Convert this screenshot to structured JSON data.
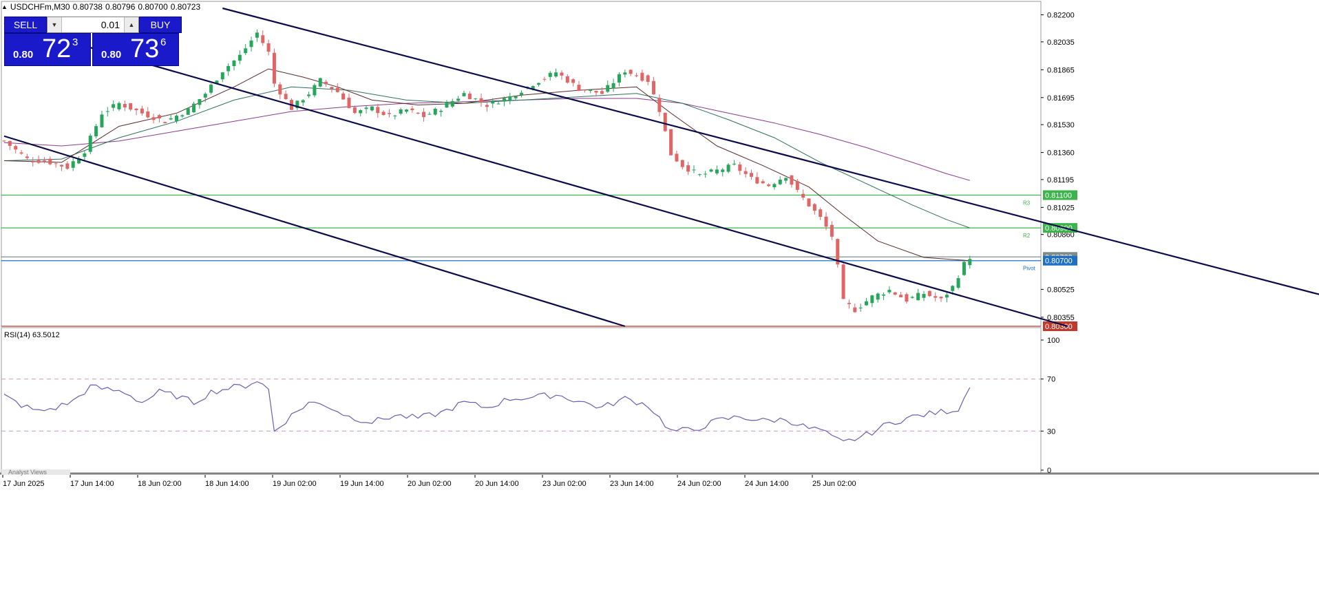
{
  "header": {
    "symbol": "USDCHFm,M30",
    "open": "0.80738",
    "high": "0.80796",
    "low": "0.80700",
    "close": "0.80723"
  },
  "trade_panel": {
    "sell_label": "SELL",
    "buy_label": "BUY",
    "lot": "0.01",
    "sell_prefix": "0.80",
    "sell_big": "72",
    "sell_sup": "3",
    "buy_prefix": "0.80",
    "buy_big": "73",
    "buy_sup": "6"
  },
  "bottom_tab": "Analyst Views",
  "chart_data": [
    {
      "type": "candlestick",
      "title": "USDCHFm,M30",
      "ylim": [
        0.803,
        0.8224
      ],
      "y_ticks": [
        "0.82200",
        "0.82035",
        "0.81865",
        "0.81695",
        "0.81530",
        "0.81360",
        "0.81195",
        "0.81025",
        "0.80860",
        "0.80525",
        "0.80355"
      ],
      "x_ticks": [
        "17 Jun 2025",
        "17 Jun 14:00",
        "18 Jun 02:00",
        "18 Jun 14:00",
        "19 Jun 02:00",
        "19 Jun 14:00",
        "20 Jun 02:00",
        "20 Jun 14:00",
        "23 Jun 02:00",
        "23 Jun 14:00",
        "24 Jun 02:00",
        "24 Jun 14:00",
        "25 Jun 02:00"
      ],
      "close_path": [
        [
          0,
          0.8143
        ],
        [
          4,
          0.8132
        ],
        [
          8,
          0.813
        ],
        [
          11,
          0.8127
        ],
        [
          14,
          0.8137
        ],
        [
          17,
          0.816
        ],
        [
          20,
          0.8166
        ],
        [
          24,
          0.816
        ],
        [
          28,
          0.8155
        ],
        [
          32,
          0.8162
        ],
        [
          35,
          0.8172
        ],
        [
          38,
          0.8186
        ],
        [
          41,
          0.8195
        ],
        [
          44,
          0.8209
        ],
        [
          46,
          0.8197
        ],
        [
          47,
          0.8178
        ],
        [
          50,
          0.8163
        ],
        [
          53,
          0.8172
        ],
        [
          55,
          0.818
        ],
        [
          58,
          0.8173
        ],
        [
          61,
          0.816
        ],
        [
          64,
          0.8163
        ],
        [
          67,
          0.8158
        ],
        [
          70,
          0.8162
        ],
        [
          73,
          0.8158
        ],
        [
          76,
          0.8163
        ],
        [
          80,
          0.8172
        ],
        [
          84,
          0.8165
        ],
        [
          88,
          0.817
        ],
        [
          92,
          0.8178
        ],
        [
          96,
          0.8185
        ],
        [
          100,
          0.8175
        ],
        [
          104,
          0.8172
        ],
        [
          108,
          0.8186
        ],
        [
          112,
          0.818
        ],
        [
          114,
          0.8162
        ],
        [
          116,
          0.8135
        ],
        [
          118,
          0.8128
        ],
        [
          121,
          0.8122
        ],
        [
          124,
          0.8125
        ],
        [
          127,
          0.8128
        ],
        [
          130,
          0.812
        ],
        [
          133,
          0.8116
        ],
        [
          136,
          0.8122
        ],
        [
          138,
          0.8112
        ],
        [
          140,
          0.8104
        ],
        [
          142,
          0.8096
        ],
        [
          144,
          0.8085
        ],
        [
          145,
          0.8066
        ],
        [
          146,
          0.8045
        ],
        [
          148,
          0.804
        ],
        [
          151,
          0.8048
        ],
        [
          154,
          0.8052
        ],
        [
          157,
          0.8046
        ],
        [
          160,
          0.805
        ],
        [
          163,
          0.8046
        ],
        [
          165,
          0.8054
        ],
        [
          167,
          0.8068
        ],
        [
          168,
          0.80723
        ]
      ],
      "ma_fast": [
        [
          0,
          0.8131
        ],
        [
          10,
          0.813
        ],
        [
          20,
          0.8152
        ],
        [
          30,
          0.816
        ],
        [
          40,
          0.8176
        ],
        [
          46,
          0.8187
        ],
        [
          52,
          0.8182
        ],
        [
          58,
          0.8176
        ],
        [
          64,
          0.8168
        ],
        [
          72,
          0.8165
        ],
        [
          80,
          0.8166
        ],
        [
          90,
          0.8171
        ],
        [
          100,
          0.8174
        ],
        [
          110,
          0.8176
        ],
        [
          116,
          0.816
        ],
        [
          124,
          0.814
        ],
        [
          132,
          0.8128
        ],
        [
          140,
          0.8115
        ],
        [
          146,
          0.8098
        ],
        [
          152,
          0.8082
        ],
        [
          160,
          0.8072
        ],
        [
          168,
          0.807
        ]
      ],
      "ma_mid": [
        [
          0,
          0.8131
        ],
        [
          10,
          0.8132
        ],
        [
          20,
          0.8145
        ],
        [
          30,
          0.8155
        ],
        [
          40,
          0.8168
        ],
        [
          50,
          0.8176
        ],
        [
          60,
          0.8174
        ],
        [
          70,
          0.8168
        ],
        [
          80,
          0.8166
        ],
        [
          90,
          0.8168
        ],
        [
          100,
          0.817
        ],
        [
          110,
          0.8172
        ],
        [
          118,
          0.8166
        ],
        [
          126,
          0.8156
        ],
        [
          134,
          0.8145
        ],
        [
          142,
          0.813
        ],
        [
          150,
          0.8117
        ],
        [
          158,
          0.8104
        ],
        [
          164,
          0.8095
        ],
        [
          168,
          0.809
        ]
      ],
      "ma_slow": [
        [
          0,
          0.8142
        ],
        [
          10,
          0.814
        ],
        [
          20,
          0.8143
        ],
        [
          30,
          0.8149
        ],
        [
          40,
          0.8155
        ],
        [
          50,
          0.8161
        ],
        [
          60,
          0.8164
        ],
        [
          70,
          0.8166
        ],
        [
          80,
          0.8167
        ],
        [
          90,
          0.8168
        ],
        [
          100,
          0.8169
        ],
        [
          110,
          0.8169
        ],
        [
          118,
          0.8166
        ],
        [
          126,
          0.816
        ],
        [
          134,
          0.8154
        ],
        [
          142,
          0.8147
        ],
        [
          150,
          0.8139
        ],
        [
          158,
          0.813
        ],
        [
          164,
          0.8123
        ],
        [
          168,
          0.8119
        ]
      ],
      "horizontal_levels": [
        {
          "value": "0.81100",
          "color": "#3cb44b",
          "tag": "R3"
        },
        {
          "value": "0.80900",
          "color": "#3cb44b",
          "tag": "R2"
        },
        {
          "value": "0.80723",
          "color": "#7f8c8d",
          "tag": ""
        },
        {
          "value": "0.80700",
          "color": "#1f6fc5",
          "tag": "Pivot"
        },
        {
          "value": "0.80300",
          "color": "#c0392b",
          "tag": ""
        }
      ],
      "trend_channel": [
        {
          "from": [
            38,
            0.8224
          ],
          "to": [
            250,
            0.803
          ]
        },
        {
          "from": [
            0,
            0.8215
          ],
          "to": [
            185,
            0.803
          ]
        },
        {
          "from": [
            0,
            0.8146
          ],
          "to": [
            108,
            0.803
          ]
        }
      ]
    },
    {
      "type": "line",
      "title": "RSI(14) 63.5012",
      "ylim": [
        0,
        100
      ],
      "y_ticks": [
        "100",
        "70",
        "30",
        "0"
      ],
      "levels": [
        70,
        30
      ],
      "values": [
        [
          0,
          57
        ],
        [
          3,
          50
        ],
        [
          6,
          45
        ],
        [
          9,
          48
        ],
        [
          12,
          53
        ],
        [
          15,
          64
        ],
        [
          18,
          62
        ],
        [
          21,
          60
        ],
        [
          24,
          52
        ],
        [
          27,
          60
        ],
        [
          30,
          57
        ],
        [
          33,
          52
        ],
        [
          36,
          60
        ],
        [
          39,
          63
        ],
        [
          42,
          65
        ],
        [
          44,
          69
        ],
        [
          46,
          62
        ],
        [
          47,
          30
        ],
        [
          50,
          42
        ],
        [
          53,
          52
        ],
        [
          56,
          50
        ],
        [
          60,
          41
        ],
        [
          64,
          37
        ],
        [
          68,
          42
        ],
        [
          72,
          40
        ],
        [
          76,
          44
        ],
        [
          80,
          52
        ],
        [
          84,
          48
        ],
        [
          88,
          55
        ],
        [
          92,
          56
        ],
        [
          96,
          58
        ],
        [
          100,
          53
        ],
        [
          104,
          48
        ],
        [
          108,
          55
        ],
        [
          112,
          50
        ],
        [
          114,
          40
        ],
        [
          116,
          30
        ],
        [
          120,
          31
        ],
        [
          124,
          38
        ],
        [
          128,
          41
        ],
        [
          132,
          38
        ],
        [
          136,
          39
        ],
        [
          140,
          32
        ],
        [
          142,
          31
        ],
        [
          144,
          25
        ],
        [
          146,
          21
        ],
        [
          150,
          27
        ],
        [
          154,
          36
        ],
        [
          158,
          41
        ],
        [
          162,
          44
        ],
        [
          166,
          47
        ],
        [
          168,
          63.5012
        ]
      ]
    }
  ]
}
